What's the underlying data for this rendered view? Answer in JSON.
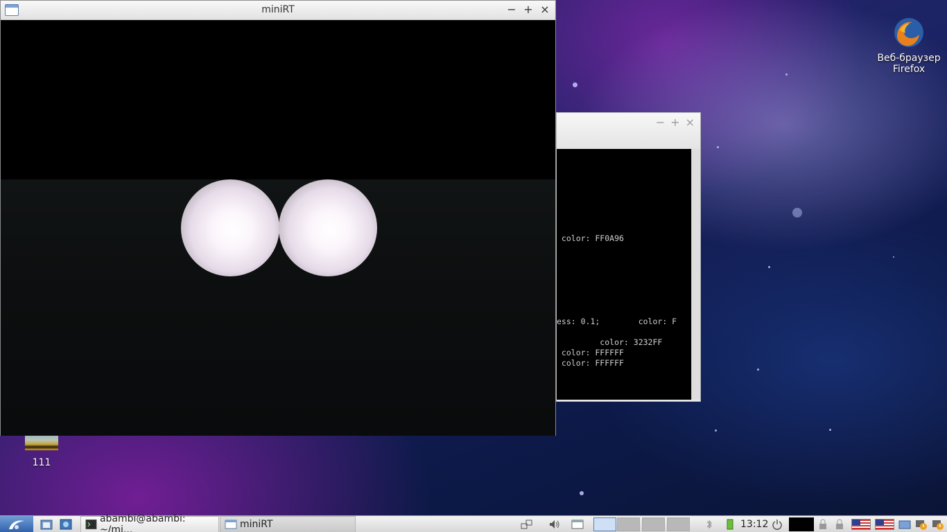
{
  "desktop": {
    "icons": [
      {
        "label": "Веб-браузер Firefox",
        "icon": "firefox-icon"
      },
      {
        "label": "111",
        "icon": "image-file-icon"
      }
    ]
  },
  "minirt_window": {
    "title": "miniRT",
    "controls": {
      "minimize": "−",
      "maximize": "+",
      "close": "×"
    }
  },
  "terminal_window": {
    "controls": {
      "minimize": "−",
      "maximize": "+",
      "close": "×"
    },
    "lines": [
      " color: FF0A96",
      "ess: 0.1;        color: F",
      "         color: 3232FF",
      " color: FFFFFF",
      " color: FFFFFF"
    ]
  },
  "taskbar": {
    "terminal_task": "abambi@abambi: ~/mi...",
    "minirt_task": "miniRT",
    "clock": "13:12",
    "accent": "#3d6fb8"
  }
}
